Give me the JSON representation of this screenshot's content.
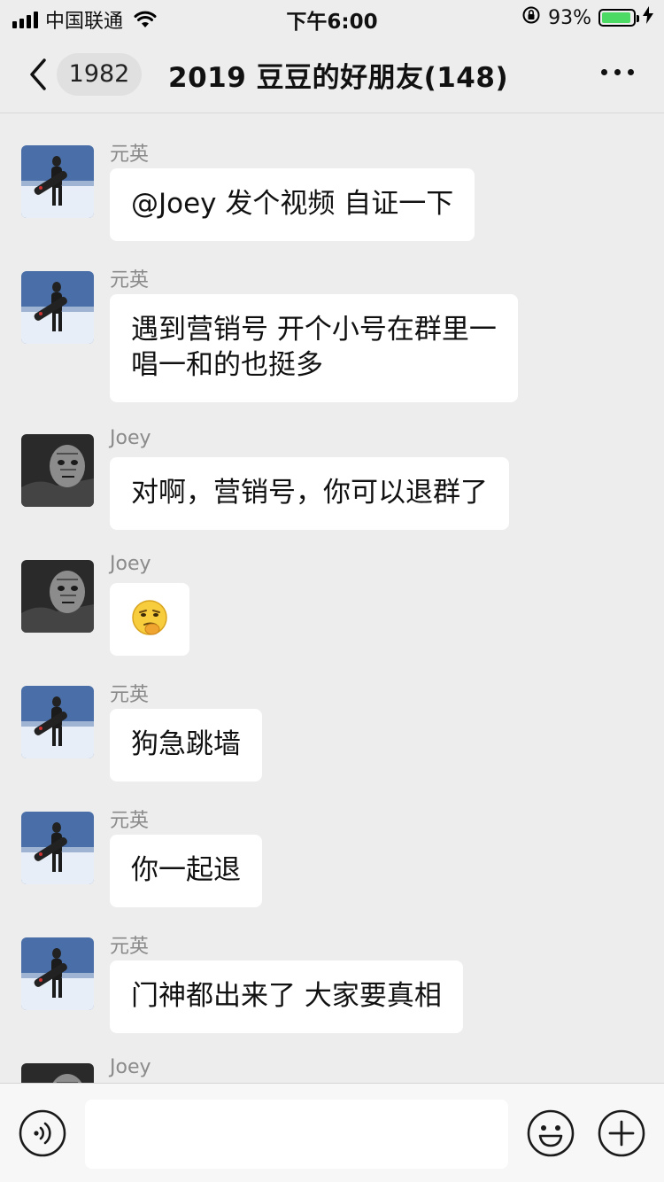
{
  "status_bar": {
    "carrier": "中国联通",
    "time": "下午6:00",
    "battery_percent": "93%",
    "battery_level": 0.93
  },
  "nav": {
    "unread_count": "1982",
    "title": "2019 豆豆的好朋友(148)"
  },
  "messages": [
    {
      "sender": "元英",
      "avatar": "snowboarder-avatar",
      "lines": [
        "@Joey 发个视频 自证一下"
      ]
    },
    {
      "sender": "元英",
      "avatar": "snowboarder-avatar",
      "lines": [
        "遇到营销号 开个小号在群里一",
        "唱一和的也挺多"
      ]
    },
    {
      "sender": "Joey",
      "avatar": "tattooed-man-avatar",
      "lines": [
        "对啊，营销号，你可以退群了"
      ]
    },
    {
      "sender": "Joey",
      "avatar": "tattooed-man-avatar",
      "emoji": "smirk-emoji"
    },
    {
      "sender": "元英",
      "avatar": "snowboarder-avatar",
      "lines": [
        "狗急跳墙"
      ]
    },
    {
      "sender": "元英",
      "avatar": "snowboarder-avatar",
      "lines": [
        "你一起退"
      ]
    },
    {
      "sender": "元英",
      "avatar": "snowboarder-avatar",
      "lines": [
        "门神都出来了 大家要真相"
      ]
    },
    {
      "sender": "Joey",
      "avatar": "tattooed-man-avatar",
      "lines": []
    }
  ],
  "input_bar": {
    "placeholder": "",
    "icons": [
      "voice-icon",
      "emoji-icon",
      "plus-icon"
    ]
  },
  "colors": {
    "background": "#ededed",
    "bubble": "#ffffff",
    "battery": "#4cd964"
  }
}
